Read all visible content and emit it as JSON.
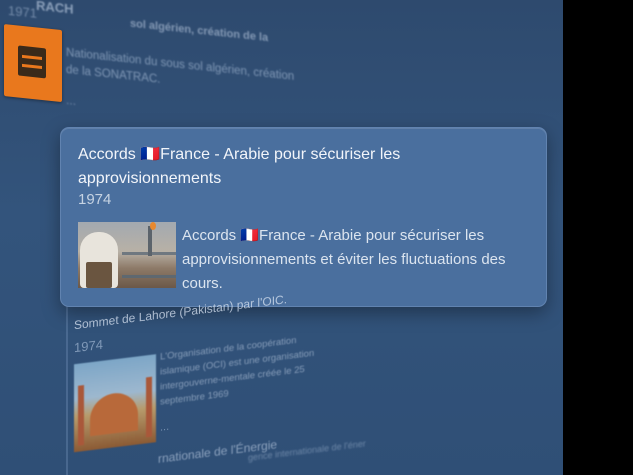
{
  "timeline": {
    "items": [
      {
        "year": "1971",
        "title_fragment": "RACH",
        "title_fragment_2": "sol algérien, création de la",
        "description": "Nationalisation du sous sol algérien, création de la SONATRAC.",
        "more": "...",
        "logo_icon": "sonatrach-logo-icon"
      },
      {
        "title": "Accords 🇫🇷France - Arabie pour sécuriser les approvisionnements",
        "year": "1974",
        "description": "Accords 🇫🇷France - Arabie pour sécuriser les approvisionnements et éviter les fluctuations des cours.",
        "image_icon": "photo-saudi-official-oil-facility"
      },
      {
        "title": "Sommet de Lahore (Pakistan) par l'OIC.",
        "year": "1974",
        "description": "L'Organisation de la coopération islamique (OCI) est une organisation intergouverne-mentale créée le 25 septembre 1969",
        "more": "...",
        "image_icon": "photo-lahore-mosque"
      },
      {
        "title_fragment": "rnationale de l'Énergie",
        "desc_fragment": "gence internationale de l'éner"
      }
    ]
  },
  "colors": {
    "background": "#2f4f76",
    "card": "#4a6f9e",
    "logo": "#e9781d"
  }
}
